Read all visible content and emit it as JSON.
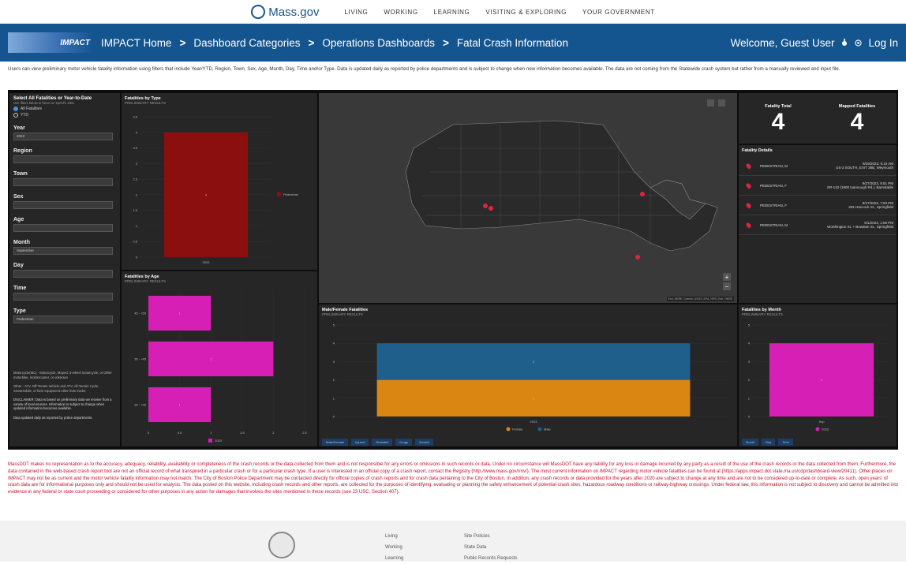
{
  "topbar": {
    "brand": "Mass.gov",
    "nav": [
      "LIVING",
      "WORKING",
      "LEARNING",
      "VISITING & EXPLORING",
      "YOUR GOVERNMENT"
    ]
  },
  "banner": {
    "logo_text": "IMPACT",
    "crumbs": [
      "IMPACT Home",
      "Dashboard Categories",
      "Operations Dashboards",
      "Fatal Crash Information"
    ],
    "separator": ">",
    "welcome": "Welcome, Guest User",
    "login": "Log In"
  },
  "intro": "Users can view preliminary motor vehicle fatality information using filters that include Year/YTD, Region, Town, Sex, Age, Month, Day, Time and/or Type. Data is updated daily as reported by police departments and is subject to change when new information becomes available. The data are not coming from the Statewide crash system but rather from a manually reviewed and input file.",
  "filters": {
    "title": "Select All Fatalities or Year-to-Date",
    "subtitle": "Use filters below to focus on specific data",
    "radios": [
      {
        "label": "All Fatalities",
        "selected": true
      },
      {
        "label": "YTD",
        "selected": false
      }
    ],
    "fields": [
      {
        "label": "Year",
        "value": "2023"
      },
      {
        "label": "Region",
        "value": ""
      },
      {
        "label": "Town",
        "value": ""
      },
      {
        "label": "Sex",
        "value": ""
      },
      {
        "label": "Age",
        "value": ""
      },
      {
        "label": "Month",
        "value": "September"
      },
      {
        "label": "Day",
        "value": ""
      },
      {
        "label": "Time",
        "value": ""
      },
      {
        "label": "Type",
        "value": "Pedestrian"
      }
    ],
    "notes": [
      "Motorcycle(MC) - Motorcycle, Moped, 3-wheel motorcycle, or Other motorbike, motorscooter, or unknown",
      "Other - ATV, Off-Terrain Vehicle and ATV, All-Terrain Cycle, Snowmobile, or farm equipment other than trucks",
      "DISCLAIMER: Data is based on preliminary data we receive from a variety of local sources. Information is subject to change when updated information becomes available.",
      "Data updated daily as reported by police departments."
    ]
  },
  "by_type": {
    "title": "Fatalities by Type",
    "subtitle": "PRELIMINARY RESULTS",
    "legend": "Pedestrian"
  },
  "by_age": {
    "title": "Fatalities by Age",
    "subtitle": "PRELIMINARY RESULTS",
    "legend": "2023"
  },
  "map": {
    "attribution": "Esri, HERE, Garmin, USGS, EPA, NPS | Esri, HERE"
  },
  "kpis": {
    "total_label": "Fatality Total",
    "total_value": "4",
    "mapped_label": "Mapped Fatalities",
    "mapped_value": "4"
  },
  "details": {
    "title": "Fatality Details",
    "rows": [
      {
        "who": "PEDESTRIAN, M",
        "date": "9/29/2023, 5:10 AM",
        "where": "US-3 SOUTH, EXIT 38B, Weymouth"
      },
      {
        "who": "PEDESTRIAN, F",
        "date": "9/27/2023, 9:51 PM",
        "where": "SR-132 (1900 Iyannough Rd.), Barnstable"
      },
      {
        "who": "PEDESTRIAN, F",
        "date": "9/17/2023, 7:53 PM",
        "where": "291 Hancock St., Springfield"
      },
      {
        "who": "PEDESTRIAN, M",
        "date": "9/1/2023, 1:59 PM",
        "where": "Worthington St. + Bowdoin St., Springfield"
      }
    ]
  },
  "sex_chart": {
    "title": "Male/Female Fatalities",
    "subtitle": "PRELIMINARY RESULTS",
    "legend": [
      "Female",
      "Male"
    ],
    "tabs": [
      "Male/Female",
      "Injured",
      "Restraint",
      "Drugs",
      "Alcohol"
    ]
  },
  "month_chart": {
    "title": "Fatalities by Month",
    "subtitle": "PRELIMINARY RESULTS",
    "legend": "2023",
    "tabs": [
      "Month",
      "Day",
      "Time"
    ]
  },
  "disclaimer": "MassDOT makes no representation as to the accuracy, adequacy, reliability, availability or completeness of the crash records or the data collected from them and is not responsible for any errors or omissions in such records or data. Under no circumstance will MassDOT have any liability for any loss or damage incurred by any party as a result of the use of the crash records or the data collected from them. Furthermore, the data contained in the web-based crash report tool are not an official record of what transpired in a particular crash or for a particular crash type. If a user is interested in an official copy of a crash report, contact the Registry (http://www.mass.gov/rmv/). The most current information on IMPACT regarding motor vehicle fatalities can be found at (https://apps.impact.dot.state.ma.us/cdp/dashboard-view/20411). Other places on IMPACT may not be as current and the motor vehicle fatality information may not match. The City of Boston Police Department may be contacted directly for official copies of crash reports and for crash data pertaining to the City of Boston. In addition, any crash records or data provided for the years after 2020 are subject to change at any time and are not to be considered up-to-date or complete. As such, open years' of crash data are for informational purposes only and should not be used for analysis. The data posted on this website, including crash records and other reports, are collected for the purposes of identifying, evaluating or planning the safety enhancement of potential crash sites, hazardous roadway conditions or railway-highway crossings. Under federal law, this information is not subject to discovery and cannot be admitted into evidence in any federal or state court proceeding or considered for other purposes in any action for damages that involves the sites mentioned in these records (see 23 USC, Section 407).",
  "footer": {
    "col1": [
      "Living",
      "Working",
      "Learning"
    ],
    "col2": [
      "Site Policies",
      "State Data",
      "Public Records Requests"
    ]
  },
  "chart_data": [
    {
      "type": "bar",
      "title": "Fatalities by Type",
      "subtitle": "PRELIMINARY RESULTS",
      "categories": [
        "2023"
      ],
      "series": [
        {
          "name": "Pedestrian",
          "values": [
            4
          ]
        }
      ],
      "ylim": [
        0,
        4.5
      ],
      "yticks": [
        0,
        0.5,
        1,
        1.5,
        2,
        2.5,
        3,
        3.5,
        4,
        4.5
      ],
      "data_labels": [
        "4"
      ],
      "color": "#8b0f0f"
    },
    {
      "type": "bar",
      "orientation": "horizontal",
      "title": "Fatalities by Age",
      "subtitle": "PRELIMINARY RESULTS",
      "categories": [
        "45 - <55",
        "35 - <45",
        "25 - <35"
      ],
      "series": [
        {
          "name": "2023",
          "values": [
            1,
            2,
            1
          ]
        }
      ],
      "xlim": [
        0,
        2.5
      ],
      "xticks": [
        0,
        0.5,
        1,
        1.5,
        2,
        2.5
      ],
      "color": "#d61fb5"
    },
    {
      "type": "bar",
      "stacked": true,
      "title": "Male/Female Fatalities",
      "subtitle": "PRELIMINARY RESULTS",
      "categories": [
        "2023"
      ],
      "series": [
        {
          "name": "Female",
          "values": [
            2
          ],
          "color": "#d98613"
        },
        {
          "name": "Male",
          "values": [
            2
          ],
          "color": "#1f5f8b"
        }
      ],
      "ylim": [
        0,
        5
      ],
      "yticks": [
        0,
        1,
        2,
        3,
        4,
        5
      ]
    },
    {
      "type": "bar",
      "title": "Fatalities by Month",
      "subtitle": "PRELIMINARY RESULTS",
      "categories": [
        "Sep"
      ],
      "series": [
        {
          "name": "2023",
          "values": [
            4
          ]
        }
      ],
      "ylim": [
        0,
        5
      ],
      "yticks": [
        0,
        1,
        2,
        3,
        4,
        5
      ],
      "data_labels": [
        "4"
      ],
      "color": "#d61fb5"
    }
  ]
}
